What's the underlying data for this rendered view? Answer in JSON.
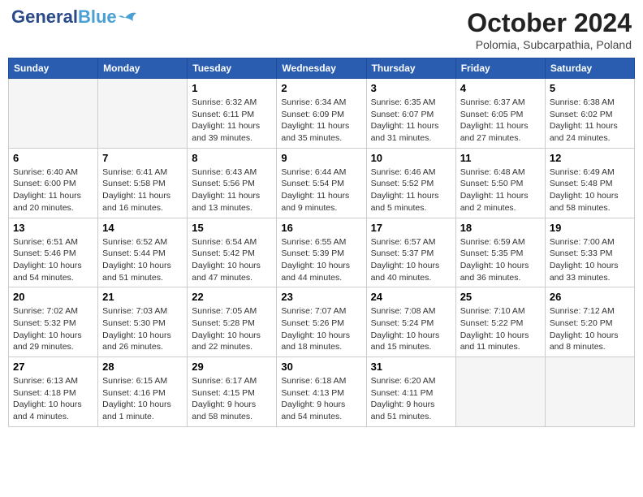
{
  "header": {
    "logo_line1": "General",
    "logo_line2": "Blue",
    "month": "October 2024",
    "location": "Polomia, Subcarpathia, Poland"
  },
  "weekdays": [
    "Sunday",
    "Monday",
    "Tuesday",
    "Wednesday",
    "Thursday",
    "Friday",
    "Saturday"
  ],
  "weeks": [
    [
      {
        "day": "",
        "info": ""
      },
      {
        "day": "",
        "info": ""
      },
      {
        "day": "1",
        "info": "Sunrise: 6:32 AM\nSunset: 6:11 PM\nDaylight: 11 hours and 39 minutes."
      },
      {
        "day": "2",
        "info": "Sunrise: 6:34 AM\nSunset: 6:09 PM\nDaylight: 11 hours and 35 minutes."
      },
      {
        "day": "3",
        "info": "Sunrise: 6:35 AM\nSunset: 6:07 PM\nDaylight: 11 hours and 31 minutes."
      },
      {
        "day": "4",
        "info": "Sunrise: 6:37 AM\nSunset: 6:05 PM\nDaylight: 11 hours and 27 minutes."
      },
      {
        "day": "5",
        "info": "Sunrise: 6:38 AM\nSunset: 6:02 PM\nDaylight: 11 hours and 24 minutes."
      }
    ],
    [
      {
        "day": "6",
        "info": "Sunrise: 6:40 AM\nSunset: 6:00 PM\nDaylight: 11 hours and 20 minutes."
      },
      {
        "day": "7",
        "info": "Sunrise: 6:41 AM\nSunset: 5:58 PM\nDaylight: 11 hours and 16 minutes."
      },
      {
        "day": "8",
        "info": "Sunrise: 6:43 AM\nSunset: 5:56 PM\nDaylight: 11 hours and 13 minutes."
      },
      {
        "day": "9",
        "info": "Sunrise: 6:44 AM\nSunset: 5:54 PM\nDaylight: 11 hours and 9 minutes."
      },
      {
        "day": "10",
        "info": "Sunrise: 6:46 AM\nSunset: 5:52 PM\nDaylight: 11 hours and 5 minutes."
      },
      {
        "day": "11",
        "info": "Sunrise: 6:48 AM\nSunset: 5:50 PM\nDaylight: 11 hours and 2 minutes."
      },
      {
        "day": "12",
        "info": "Sunrise: 6:49 AM\nSunset: 5:48 PM\nDaylight: 10 hours and 58 minutes."
      }
    ],
    [
      {
        "day": "13",
        "info": "Sunrise: 6:51 AM\nSunset: 5:46 PM\nDaylight: 10 hours and 54 minutes."
      },
      {
        "day": "14",
        "info": "Sunrise: 6:52 AM\nSunset: 5:44 PM\nDaylight: 10 hours and 51 minutes."
      },
      {
        "day": "15",
        "info": "Sunrise: 6:54 AM\nSunset: 5:42 PM\nDaylight: 10 hours and 47 minutes."
      },
      {
        "day": "16",
        "info": "Sunrise: 6:55 AM\nSunset: 5:39 PM\nDaylight: 10 hours and 44 minutes."
      },
      {
        "day": "17",
        "info": "Sunrise: 6:57 AM\nSunset: 5:37 PM\nDaylight: 10 hours and 40 minutes."
      },
      {
        "day": "18",
        "info": "Sunrise: 6:59 AM\nSunset: 5:35 PM\nDaylight: 10 hours and 36 minutes."
      },
      {
        "day": "19",
        "info": "Sunrise: 7:00 AM\nSunset: 5:33 PM\nDaylight: 10 hours and 33 minutes."
      }
    ],
    [
      {
        "day": "20",
        "info": "Sunrise: 7:02 AM\nSunset: 5:32 PM\nDaylight: 10 hours and 29 minutes."
      },
      {
        "day": "21",
        "info": "Sunrise: 7:03 AM\nSunset: 5:30 PM\nDaylight: 10 hours and 26 minutes."
      },
      {
        "day": "22",
        "info": "Sunrise: 7:05 AM\nSunset: 5:28 PM\nDaylight: 10 hours and 22 minutes."
      },
      {
        "day": "23",
        "info": "Sunrise: 7:07 AM\nSunset: 5:26 PM\nDaylight: 10 hours and 18 minutes."
      },
      {
        "day": "24",
        "info": "Sunrise: 7:08 AM\nSunset: 5:24 PM\nDaylight: 10 hours and 15 minutes."
      },
      {
        "day": "25",
        "info": "Sunrise: 7:10 AM\nSunset: 5:22 PM\nDaylight: 10 hours and 11 minutes."
      },
      {
        "day": "26",
        "info": "Sunrise: 7:12 AM\nSunset: 5:20 PM\nDaylight: 10 hours and 8 minutes."
      }
    ],
    [
      {
        "day": "27",
        "info": "Sunrise: 6:13 AM\nSunset: 4:18 PM\nDaylight: 10 hours and 4 minutes."
      },
      {
        "day": "28",
        "info": "Sunrise: 6:15 AM\nSunset: 4:16 PM\nDaylight: 10 hours and 1 minute."
      },
      {
        "day": "29",
        "info": "Sunrise: 6:17 AM\nSunset: 4:15 PM\nDaylight: 9 hours and 58 minutes."
      },
      {
        "day": "30",
        "info": "Sunrise: 6:18 AM\nSunset: 4:13 PM\nDaylight: 9 hours and 54 minutes."
      },
      {
        "day": "31",
        "info": "Sunrise: 6:20 AM\nSunset: 4:11 PM\nDaylight: 9 hours and 51 minutes."
      },
      {
        "day": "",
        "info": ""
      },
      {
        "day": "",
        "info": ""
      }
    ]
  ]
}
